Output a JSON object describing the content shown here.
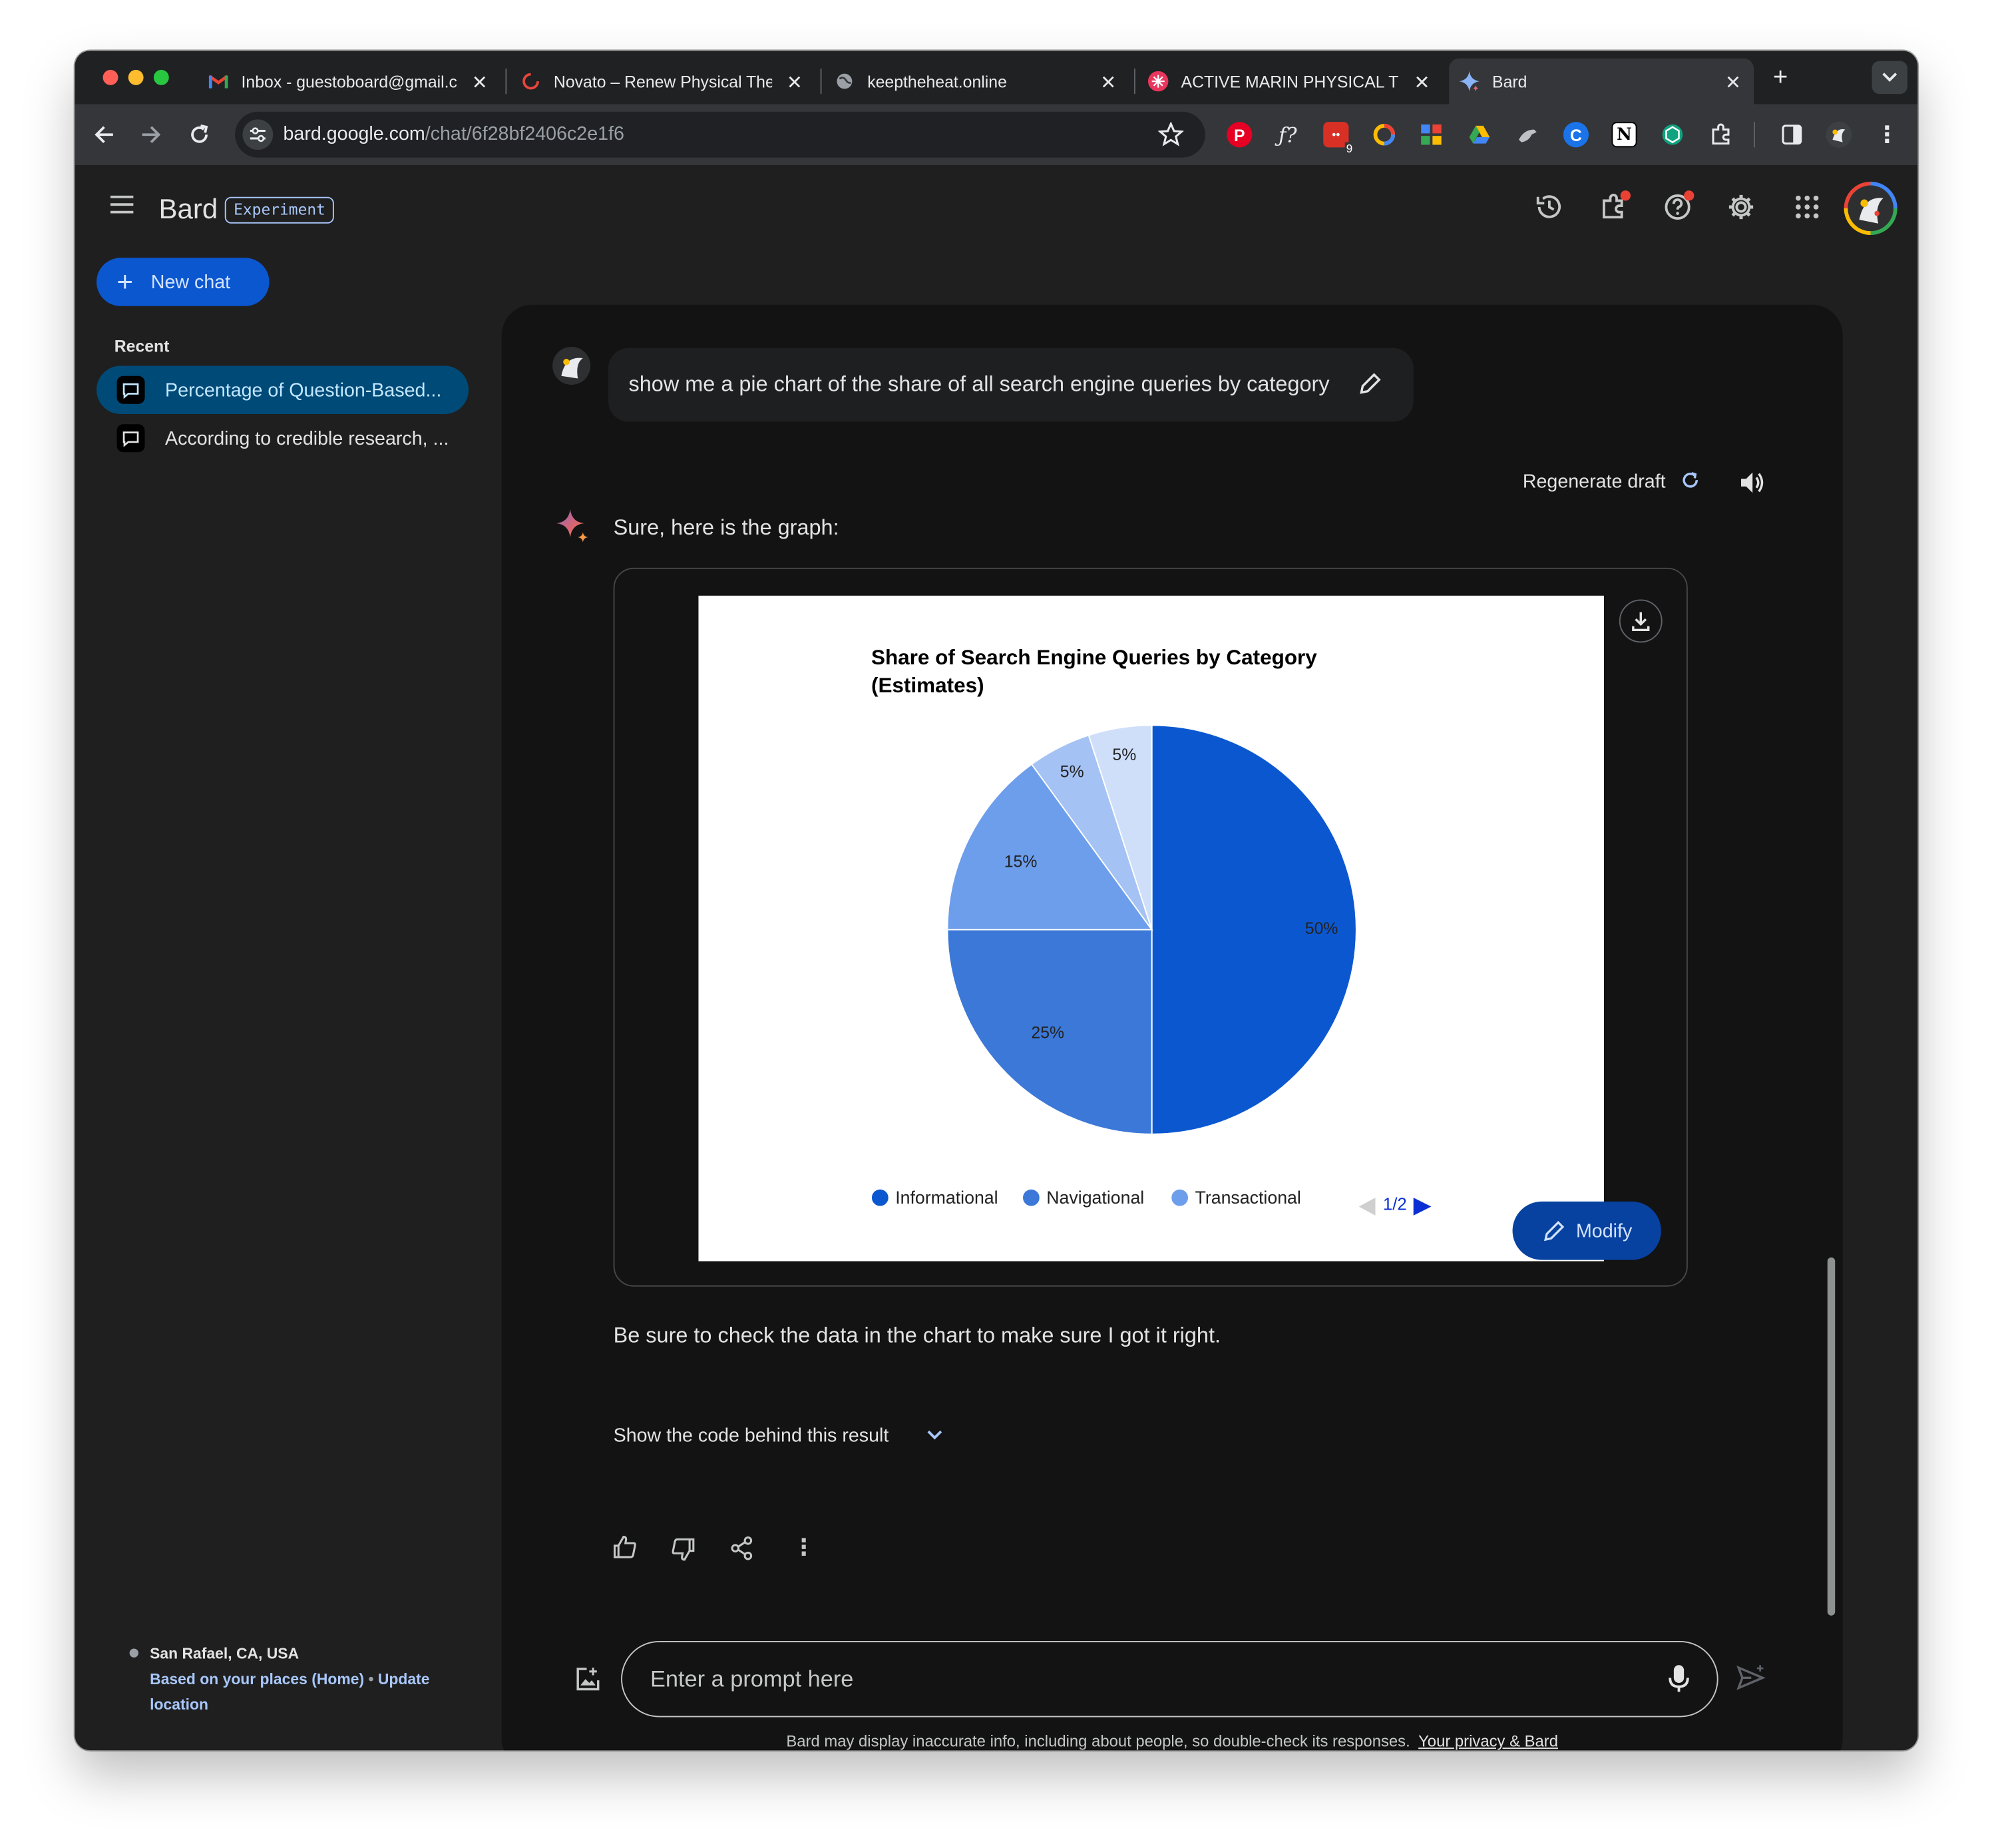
{
  "browser": {
    "tabs": [
      {
        "title": "Inbox - guestoboard@gmail.c",
        "favicon": "gmail-icon"
      },
      {
        "title": "Novato – Renew Physical The",
        "favicon": "renew-icon"
      },
      {
        "title": "keeptheheat.online",
        "favicon": "globe-icon"
      },
      {
        "title": "ACTIVE MARIN PHYSICAL TH",
        "favicon": "active-marin-icon"
      },
      {
        "title": "Bard",
        "favicon": "bard-sparkle-icon"
      }
    ],
    "url_host": "bard.google.com",
    "url_path": "/chat/6f28bf2406c2e1f6",
    "extension_badge": "9"
  },
  "app": {
    "name": "Bard",
    "badge": "Experiment"
  },
  "sidebar": {
    "new_chat": "New chat",
    "recent_label": "Recent",
    "recent_items": [
      {
        "label": "Percentage of Question-Based..."
      },
      {
        "label": "According to credible research, ..."
      }
    ],
    "location_city": "San Rafael, CA, USA",
    "location_source": "Based on your places (Home)",
    "location_sep": "•",
    "location_update_1": "Update",
    "location_update_2": "location"
  },
  "conversation": {
    "user_prompt": "show me a pie chart of the share of all search engine queries by category",
    "regenerate_label": "Regenerate draft",
    "response_intro": "Sure, here is the graph:",
    "response_note": "Be sure to check the data in the chart to make sure I got it right.",
    "show_code_label": "Show the code behind this result",
    "modify_label": "Modify",
    "legend_page": "1/2"
  },
  "prompt_bar": {
    "placeholder": "Enter a prompt here",
    "disclaimer": "Bard may display inaccurate info, including about people, so double-check its responses.",
    "privacy_link": "Your privacy & Bard"
  },
  "colors": {
    "accent": "#0b57d0",
    "slice_informational": "#0b57d0",
    "slice_navigational": "#3c78d8",
    "slice_transactional": "#6d9eeb",
    "slice_other_1": "#a4c2f4",
    "slice_other_2": "#cfdff9"
  },
  "chart_data": {
    "type": "pie",
    "title_line1": "Share of Search Engine Queries by Category",
    "title_line2": "(Estimates)",
    "slices": [
      {
        "value": 50,
        "label": "50%",
        "color": "#0b57d0"
      },
      {
        "value": 25,
        "label": "25%",
        "color": "#3c78d8"
      },
      {
        "value": 15,
        "label": "15%",
        "color": "#6d9eeb"
      },
      {
        "value": 5,
        "label": "5%",
        "color": "#a4c2f4"
      },
      {
        "value": 5,
        "label": "5%",
        "color": "#cfdff9"
      }
    ],
    "legend": [
      {
        "name": "Informational",
        "color": "#0b57d0"
      },
      {
        "name": "Navigational",
        "color": "#3c78d8"
      },
      {
        "name": "Transactional",
        "color": "#6d9eeb"
      }
    ],
    "legend_placement": "bottom"
  }
}
